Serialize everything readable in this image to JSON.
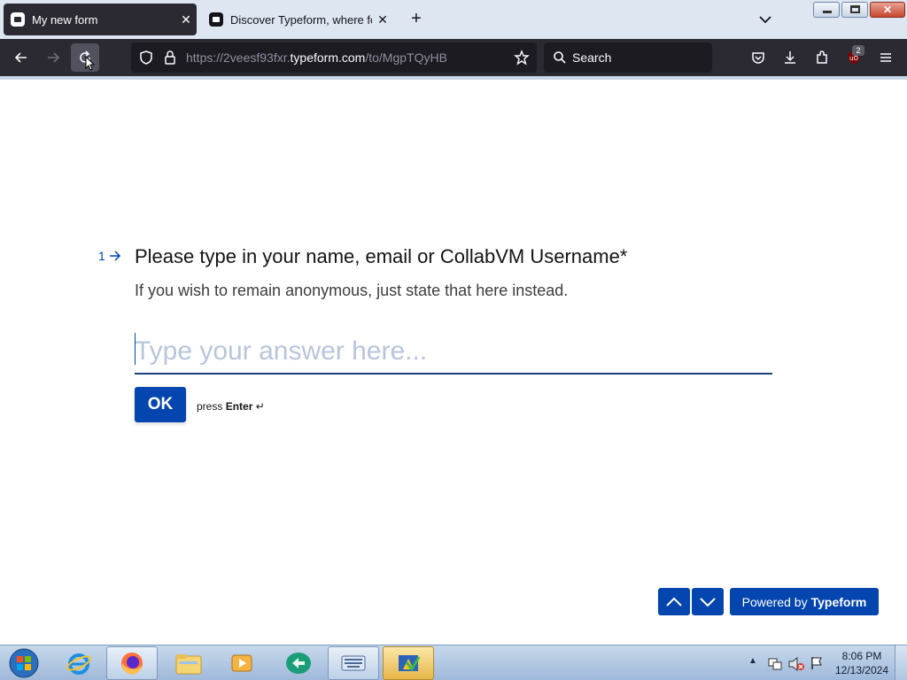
{
  "browser": {
    "tabs": [
      {
        "title": "My new form",
        "active": true
      },
      {
        "title": "Discover Typeform, where forms",
        "active": false
      }
    ],
    "url": {
      "prefix": "https://2veesf93fxr.",
      "domain": "typeform.com",
      "path": "/to/MgpTQyHB"
    },
    "search_placeholder": "Search",
    "extension_badge": "2"
  },
  "form": {
    "question_number": "1",
    "question_title": "Please type in your name, email or CollabVM Username*",
    "question_description": "If you wish to remain anonymous, just state that here instead.",
    "answer_placeholder": "Type your answer here...",
    "answer_value": "",
    "ok_label": "OK",
    "press_label": "press",
    "press_key": "Enter",
    "powered_by_prefix": "Powered by",
    "powered_by_brand": "Typeform"
  },
  "taskbar": {
    "time": "8:06 PM",
    "date": "12/13/2024"
  },
  "colors": {
    "accent": "#0445af",
    "browser_chrome": "#2b2a33",
    "tabstrip": "#dde6f1"
  }
}
